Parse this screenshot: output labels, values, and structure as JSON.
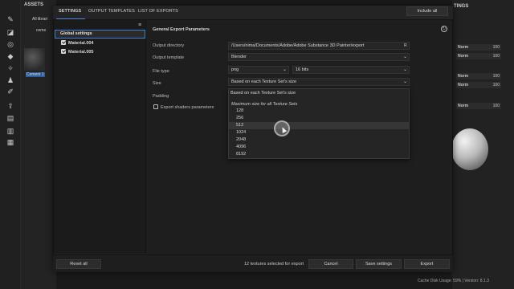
{
  "background": {
    "assets_panel": {
      "title": "ASSETS",
      "library": "All librari",
      "search": "ceme",
      "asset_name": "Cement 1"
    },
    "right_panel": {
      "title": "TINGS",
      "rows": [
        {
          "label": "Norm",
          "value": "100"
        },
        {
          "label": "Norm",
          "value": "100"
        },
        {
          "label": "Norm",
          "value": "100"
        },
        {
          "label": "Norm",
          "value": "100"
        },
        {
          "label": "Norm",
          "value": "100"
        }
      ]
    },
    "status_bar": "Cache Disk Usage:   59%  |  Version: 8.1.3"
  },
  "dialog": {
    "tabs": [
      {
        "label": "SETTINGS",
        "active": true
      },
      {
        "label": "OUTPUT TEMPLATES",
        "active": false
      },
      {
        "label": "LIST OF EXPORTS",
        "active": false
      }
    ],
    "include_all_label": "Include all",
    "list": {
      "global_settings": "Global settings",
      "materials": [
        {
          "name": "Material.004",
          "checked": true
        },
        {
          "name": "Material.005",
          "checked": true
        }
      ]
    },
    "section_title": "General Export Parameters",
    "fields": {
      "output_directory": {
        "label": "Output directory",
        "value": "/Users/nima/Documents/Adobe/Adobe Substance 3D Painter/export",
        "trailing": "R"
      },
      "output_template": {
        "label": "Output template",
        "value": "Blender"
      },
      "file_type": {
        "label": "File type",
        "value": "png",
        "bits": "16 bits"
      },
      "size": {
        "label": "Size",
        "value": "Based on each Texture Set's size"
      },
      "padding": {
        "label": "Padding"
      },
      "export_shaders": {
        "label": "Export shaders parameters",
        "checked": false
      }
    },
    "size_menu": {
      "header": "Based on each Texture Set's size",
      "subheader": "Maximum size for all Texture Sets",
      "options": [
        "128",
        "256",
        "512",
        "1024",
        "2048",
        "4096",
        "8192"
      ],
      "hovered": "512"
    },
    "footer": {
      "reset_label": "Reset all",
      "export_count": "12 textures selected for export",
      "cancel_label": "Cancel",
      "save_label": "Save settings",
      "export_label": "Export"
    }
  }
}
